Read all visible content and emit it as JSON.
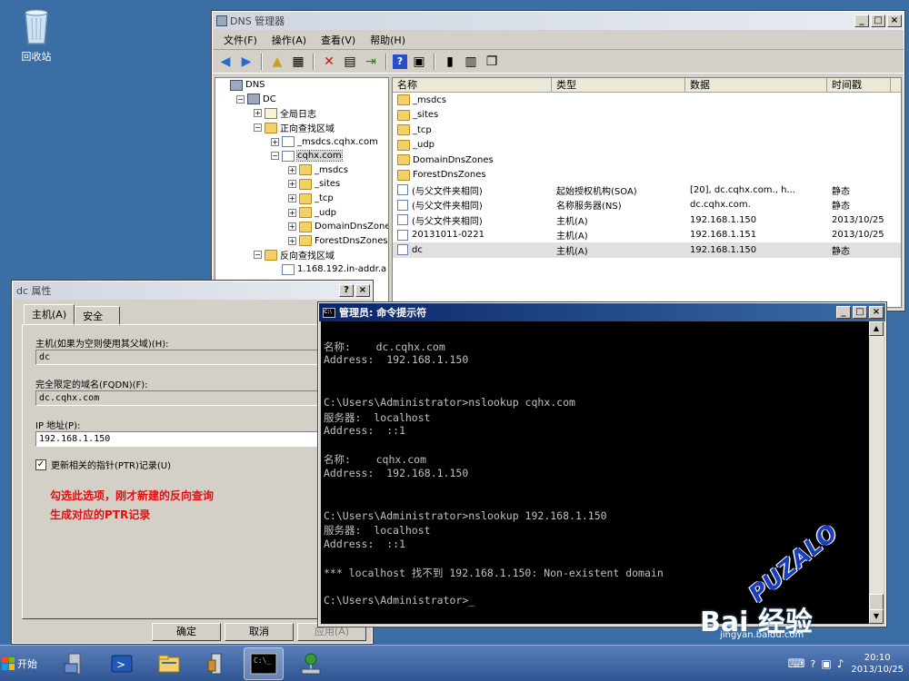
{
  "desktop": {
    "recycle_bin": "回收站"
  },
  "dns": {
    "title": "DNS 管理器",
    "menu": [
      "文件(F)",
      "操作(A)",
      "查看(V)",
      "帮助(H)"
    ],
    "tree": [
      {
        "label": "DNS",
        "indent": 0,
        "exp": "",
        "icon": "srv"
      },
      {
        "label": "DC",
        "indent": 1,
        "exp": "−",
        "icon": "srv"
      },
      {
        "label": "全局日志",
        "indent": 2,
        "exp": "+",
        "icon": "log"
      },
      {
        "label": "正向查找区域",
        "indent": 2,
        "exp": "−",
        "icon": "folder"
      },
      {
        "label": "_msdcs.cqhx.com",
        "indent": 3,
        "exp": "+",
        "icon": "zone"
      },
      {
        "label": "cqhx.com",
        "indent": 3,
        "exp": "−",
        "icon": "zone",
        "selected": true
      },
      {
        "label": "_msdcs",
        "indent": 4,
        "exp": "+",
        "icon": "folder"
      },
      {
        "label": "_sites",
        "indent": 4,
        "exp": "+",
        "icon": "folder"
      },
      {
        "label": "_tcp",
        "indent": 4,
        "exp": "+",
        "icon": "folder"
      },
      {
        "label": "_udp",
        "indent": 4,
        "exp": "+",
        "icon": "folder"
      },
      {
        "label": "DomainDnsZones",
        "indent": 4,
        "exp": "+",
        "icon": "folder"
      },
      {
        "label": "ForestDnsZones",
        "indent": 4,
        "exp": "+",
        "icon": "folder"
      },
      {
        "label": "反向查找区域",
        "indent": 2,
        "exp": "−",
        "icon": "folder"
      },
      {
        "label": "1.168.192.in-addr.a",
        "indent": 3,
        "exp": "",
        "icon": "zone"
      }
    ],
    "columns": [
      "名称",
      "类型",
      "数据",
      "时间戳"
    ],
    "rows": [
      {
        "name": "_msdcs",
        "type": "",
        "data": "",
        "time": "",
        "icon": "folder"
      },
      {
        "name": "_sites",
        "type": "",
        "data": "",
        "time": "",
        "icon": "folder"
      },
      {
        "name": "_tcp",
        "type": "",
        "data": "",
        "time": "",
        "icon": "folder"
      },
      {
        "name": "_udp",
        "type": "",
        "data": "",
        "time": "",
        "icon": "folder"
      },
      {
        "name": "DomainDnsZones",
        "type": "",
        "data": "",
        "time": "",
        "icon": "folder"
      },
      {
        "name": "ForestDnsZones",
        "type": "",
        "data": "",
        "time": "",
        "icon": "folder"
      },
      {
        "name": "(与父文件夹相同)",
        "type": "起始授权机构(SOA)",
        "data": "[20], dc.cqhx.com., h...",
        "time": "静态",
        "icon": "rec"
      },
      {
        "name": "(与父文件夹相同)",
        "type": "名称服务器(NS)",
        "data": "dc.cqhx.com.",
        "time": "静态",
        "icon": "rec"
      },
      {
        "name": "(与父文件夹相同)",
        "type": "主机(A)",
        "data": "192.168.1.150",
        "time": "2013/10/25",
        "icon": "rec"
      },
      {
        "name": "20131011-0221",
        "type": "主机(A)",
        "data": "192.168.1.151",
        "time": "2013/10/25",
        "icon": "rec"
      },
      {
        "name": "dc",
        "type": "主机(A)",
        "data": "192.168.1.150",
        "time": "静态",
        "icon": "rec",
        "selected": true
      }
    ]
  },
  "props": {
    "title": "dc 属性",
    "tabs": [
      "主机(A)",
      "安全"
    ],
    "host_label": "主机(如果为空则使用其父域)(H):",
    "host_value": "dc",
    "fqdn_label": "完全限定的域名(FQDN)(F):",
    "fqdn_value": "dc.cqhx.com",
    "ip_label": "IP 地址(P):",
    "ip_value": "192.168.1.150",
    "ptr_label": "更新相关的指针(PTR)记录(U)",
    "note_line1": "勾选此选项，刚才新建的反向查询",
    "note_line2": "生成对应的PTR记录",
    "ok": "确定",
    "cancel": "取消",
    "apply": "应用(A)"
  },
  "cmd": {
    "title": "管理员: 命令提示符",
    "lines": [
      "",
      "名称:    dc.cqhx.com",
      "Address:  192.168.1.150",
      "",
      "",
      "C:\\Users\\Administrator>nslookup cqhx.com",
      "服务器:  localhost",
      "Address:  ::1",
      "",
      "名称:    cqhx.com",
      "Address:  192.168.1.150",
      "",
      "",
      "C:\\Users\\Administrator>nslookup 192.168.1.150",
      "服务器:  localhost",
      "Address:  ::1",
      "",
      "*** localhost 找不到 192.168.1.150: Non-existent domain",
      "",
      "C:\\Users\\Administrator>_"
    ]
  },
  "taskbar": {
    "start": "开始",
    "time": "20:10",
    "date": "2013/10/25"
  },
  "watermark": {
    "brand": "Bai 经验",
    "url": "jingyan.baidu.com",
    "stamp": "PUZALO"
  }
}
